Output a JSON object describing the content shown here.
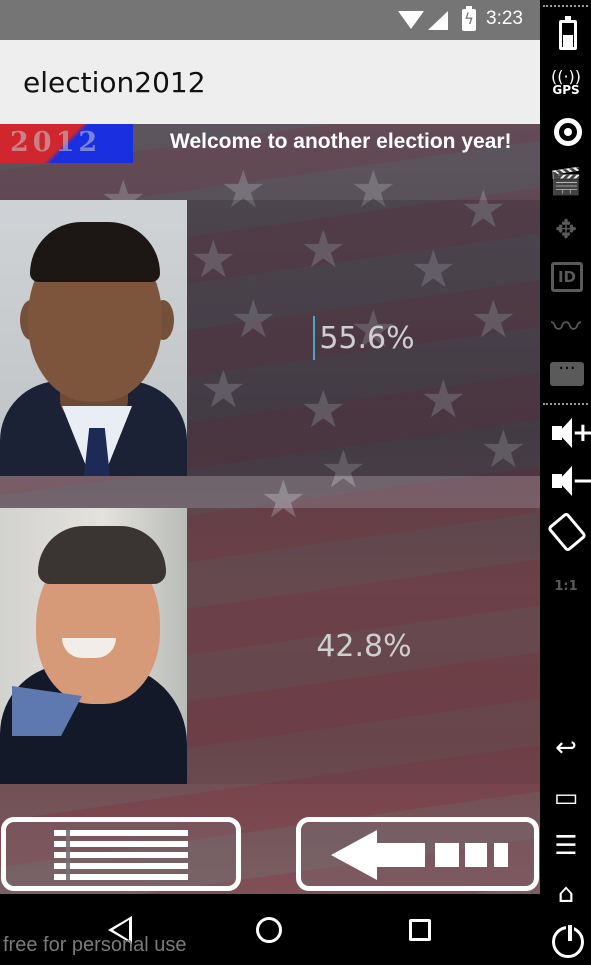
{
  "status_bar": {
    "time": "3:23"
  },
  "app": {
    "title": "election2012"
  },
  "banner": {
    "logo_text": "2012",
    "welcome": "Welcome to another election year!"
  },
  "candidates": [
    {
      "percentage": "55.6%"
    },
    {
      "percentage": "42.8%"
    }
  ],
  "watermark": "free for personal use",
  "side_toolbar": {
    "gps_label": "GPS",
    "id_label": "ID",
    "scale_label": "1:1"
  },
  "colors": {
    "status_bar": "#757575",
    "action_bar": "#eeeeee",
    "text_cursor": "#4aa6c8",
    "logo_red": "#d0262d",
    "logo_blue": "#1a2fe0"
  }
}
